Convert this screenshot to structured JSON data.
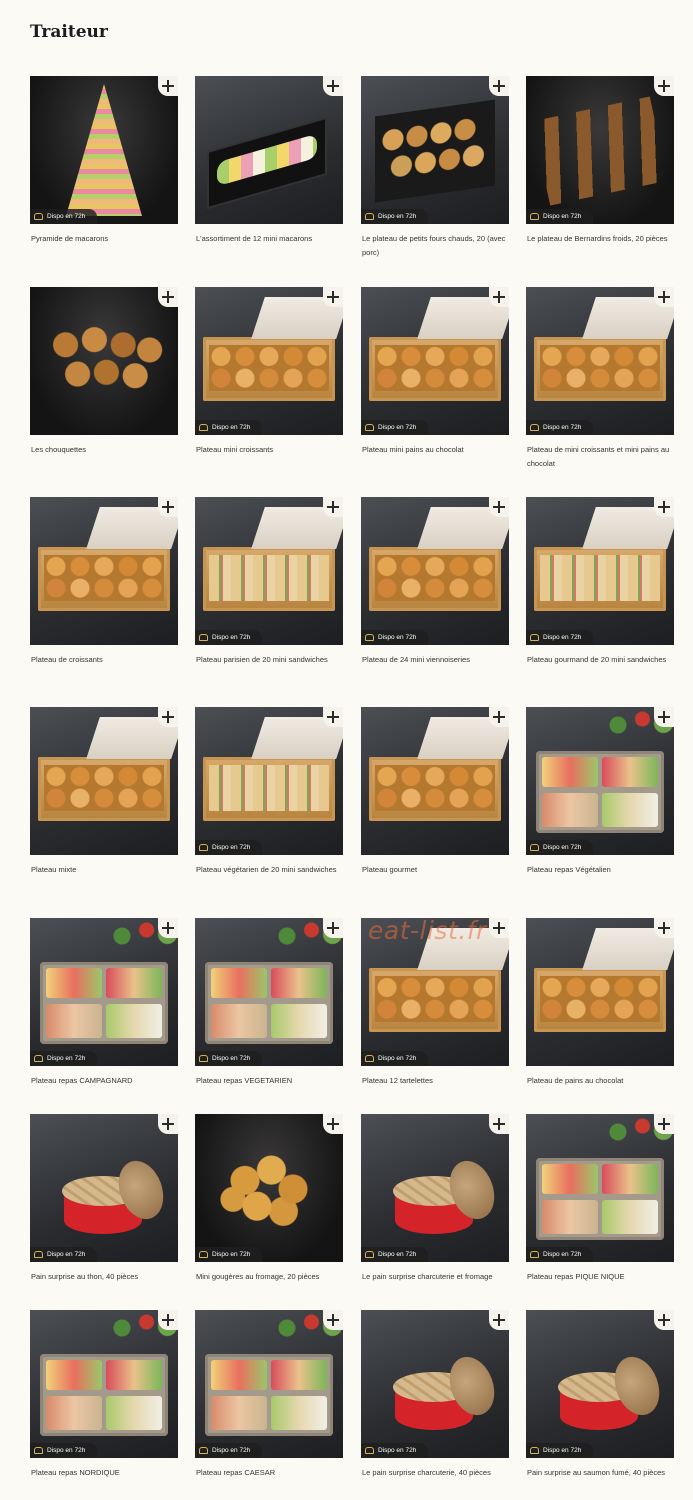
{
  "page": {
    "title": "Traiteur"
  },
  "watermark": "eat-list.fr",
  "badge_label": "Dispo en 72h",
  "products": [
    {
      "name": "Pyramide de macarons",
      "badge": true,
      "icon": "macaron-tower"
    },
    {
      "name": "L'assortiment de 12 mini macarons",
      "badge": false,
      "icon": "macaron-box"
    },
    {
      "name": "Le plateau de petits fours chauds, 20 (avec porc)",
      "badge": true,
      "icon": "petits-fours"
    },
    {
      "name": "Le plateau de Bernardins froids, 20 pièces",
      "badge": true,
      "icon": "bernardins"
    },
    {
      "name": "Les chouquettes",
      "badge": false,
      "icon": "chouquettes"
    },
    {
      "name": "Plateau mini croissants",
      "badge": true,
      "icon": "pastry-tray"
    },
    {
      "name": "Plateau mini pains au chocolat",
      "badge": true,
      "icon": "pastry-tray"
    },
    {
      "name": "Plateau de mini croissants et mini pains au chocolat",
      "badge": true,
      "icon": "pastry-tray"
    },
    {
      "name": "Plateau de croissants",
      "badge": false,
      "icon": "pastry-tray"
    },
    {
      "name": "Plateau parisien de 20 mini sandwiches",
      "badge": true,
      "icon": "sandwich-tray"
    },
    {
      "name": "Plateau de 24 mini viennoiseries",
      "badge": true,
      "icon": "pastry-tray"
    },
    {
      "name": "Plateau gourmand de 20 mini sandwiches",
      "badge": true,
      "icon": "sandwich-tray"
    },
    {
      "name": "Plateau mixte",
      "badge": false,
      "icon": "pastry-tray"
    },
    {
      "name": "Plateau végétarien de 20 mini sandwiches",
      "badge": true,
      "icon": "sandwich-tray"
    },
    {
      "name": "Plateau gourmet",
      "badge": false,
      "icon": "pastry-tray"
    },
    {
      "name": "Plateau repas Végétalien",
      "badge": true,
      "icon": "meal-box"
    },
    {
      "name": "Plateau repas CAMPAGNARD",
      "badge": true,
      "icon": "meal-box"
    },
    {
      "name": "Plateau repas VEGETARIEN",
      "badge": true,
      "icon": "meal-box"
    },
    {
      "name": "Plateau 12 tartelettes",
      "badge": true,
      "icon": "tart-tray"
    },
    {
      "name": "Plateau de pains au chocolat",
      "badge": false,
      "icon": "pastry-tray"
    },
    {
      "name": "Pain surprise au thon, 40 pièces",
      "badge": true,
      "icon": "pain-surprise"
    },
    {
      "name": "Mini gougères au fromage, 20 pièces",
      "badge": true,
      "icon": "gougeres"
    },
    {
      "name": "Le pain surprise charcuterie et fromage",
      "badge": true,
      "icon": "pain-surprise"
    },
    {
      "name": "Plateau repas PIQUE NIQUE",
      "badge": true,
      "icon": "meal-box"
    },
    {
      "name": "Plateau repas NORDIQUE",
      "badge": true,
      "icon": "meal-box"
    },
    {
      "name": "Plateau repas CAESAR",
      "badge": true,
      "icon": "meal-box"
    },
    {
      "name": "Le pain surprise charcuterie, 40 pièces",
      "badge": true,
      "icon": "pain-surprise"
    },
    {
      "name": "Pain surprise au saumon fumé, 40 pièces",
      "badge": true,
      "icon": "pain-surprise"
    }
  ]
}
